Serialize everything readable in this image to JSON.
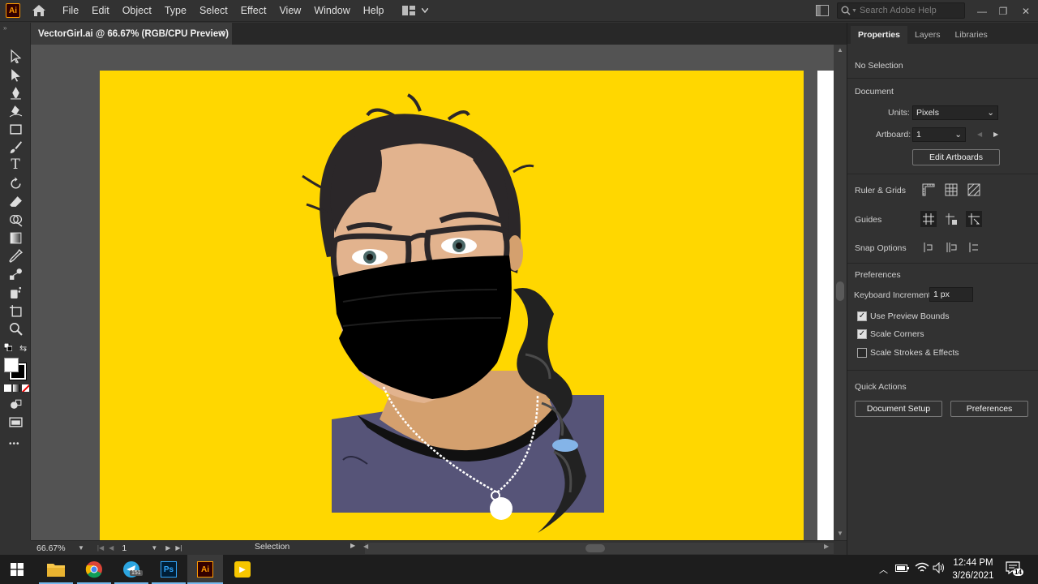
{
  "menubar": {
    "app_logo": "Ai",
    "items": [
      "File",
      "Edit",
      "Object",
      "Type",
      "Select",
      "Effect",
      "View",
      "Window",
      "Help"
    ],
    "search_placeholder": "Search Adobe Help"
  },
  "document_tab": {
    "title": "VectorGirl.ai @ 66.67% (RGB/CPU Preview)",
    "close": "×"
  },
  "toolbar": {
    "tools": [
      "selection-tool",
      "direct-selection-tool",
      "pen-tool",
      "curvature-tool",
      "rectangle-tool",
      "paintbrush-tool",
      "type-tool",
      "rotate-tool",
      "eraser-tool",
      "shape-builder-tool",
      "gradient-tool",
      "eyedropper-tool",
      "blend-tool",
      "symbol-sprayer-tool",
      "artboard-tool",
      "zoom-tool"
    ],
    "more": "•••"
  },
  "statusbar": {
    "zoom": "66.67%",
    "artboard_num": "1",
    "mode": "Selection"
  },
  "panel": {
    "tabs": [
      "Properties",
      "Layers",
      "Libraries"
    ],
    "selection_state": "No Selection",
    "document_title": "Document",
    "units_label": "Units:",
    "units_value": "Pixels",
    "artboard_label": "Artboard:",
    "artboard_value": "1",
    "edit_artboards": "Edit Artboards",
    "ruler_grids": "Ruler & Grids",
    "guides": "Guides",
    "snap_options": "Snap Options",
    "preferences_title": "Preferences",
    "keyboard_increment_label": "Keyboard Increment:",
    "keyboard_increment_value": "1 px",
    "checkboxes": [
      {
        "label": "Use Preview Bounds",
        "checked": true
      },
      {
        "label": "Scale Corners",
        "checked": true
      },
      {
        "label": "Scale Strokes & Effects",
        "checked": false
      }
    ],
    "quick_actions_title": "Quick Actions",
    "document_setup": "Document Setup",
    "preferences_button": "Preferences"
  },
  "taskbar": {
    "apps": [
      "file-explorer",
      "chrome",
      "telegram",
      "photoshop",
      "illustrator",
      "player"
    ],
    "telegram_badge": "151",
    "time": "12:44 PM",
    "date": "3/26/2021",
    "notifications": "14"
  },
  "colors": {
    "artboard": "#ffd700",
    "accent": "#ff9a00"
  }
}
